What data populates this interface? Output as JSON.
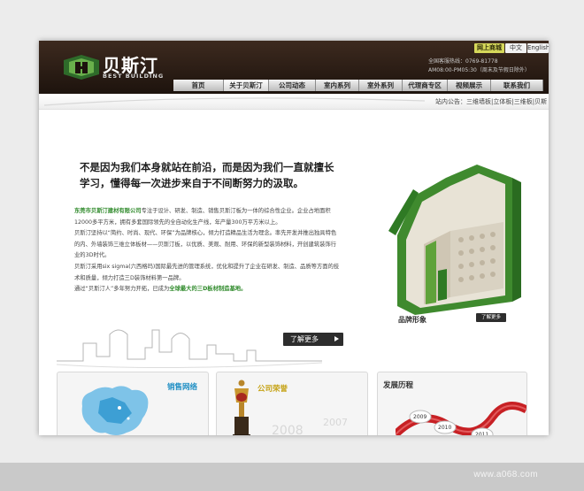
{
  "header": {
    "brand_cn": "贝斯汀",
    "brand_en": "BEST BUILDING",
    "top_links": {
      "mall": "网上商城",
      "chinese": "中文",
      "english": "English"
    },
    "hotline": "全国客服热线：0769-81778",
    "hours": "AM08:00-PM05:30（周末及节假日除外）"
  },
  "nav": {
    "items": [
      "首页",
      "关于贝斯汀",
      "公司动态",
      "室内系列",
      "室外系列",
      "代理商专区",
      "视频展示",
      "联系我们"
    ],
    "active": "关于贝斯汀"
  },
  "notice": {
    "text": "站内公告：三维墙板|立体板|三维板|贝斯"
  },
  "intro": {
    "headline": "不是因为我们本身就站在前沿，而是因为我们一直就擅长学习，懂得每一次进步来自于不间断努力的汲取。",
    "company_name": "东莞市贝斯汀建材有限公司",
    "p1_rest": "专注于设计、研发、制造、销售贝斯汀板为一体的综合性企业。企业占地面积12000多平方米，拥有多套国际领先的全自动化生产线，年产量300万平方米以上。",
    "p2": "贝斯汀坚持以“简约、时尚、现代、环保”为品牌核心，倾力打造精品生活为理念。率先开发并推出独具特色的内、外墙装饰三维立体板材——贝斯汀板，以优质、美观、耐用、环保的新型装饰材料，开创建筑装饰行业的3D时代。",
    "p3": "贝斯汀采用six sigma(六西格玛)国际最先进的管理系统，优化和提升了企业在研发、制造、品质等方面的技术和质量，倾力打造三D装饰材料第一品牌。",
    "p4_prefix": "通过“贝斯汀人”多年努力开拓，已成为",
    "p4_em": "全球最大的三D板材制造基地。",
    "learn_more": "了解更多"
  },
  "brand_image": {
    "label": "品牌形象",
    "learn_more": "了解更多"
  },
  "panels": {
    "sales": {
      "title": "销售网络"
    },
    "honor": {
      "title": "公司荣誉",
      "year1": "2008",
      "year2": "2007"
    },
    "history": {
      "title": "发展历程",
      "years": [
        "2009",
        "2010",
        "2011"
      ]
    }
  },
  "watermark": "www.a068.com",
  "colors": {
    "header_bg": "#2b1d15",
    "accent_green": "#2f8a2b",
    "title_blue": "#1f8fc4"
  }
}
